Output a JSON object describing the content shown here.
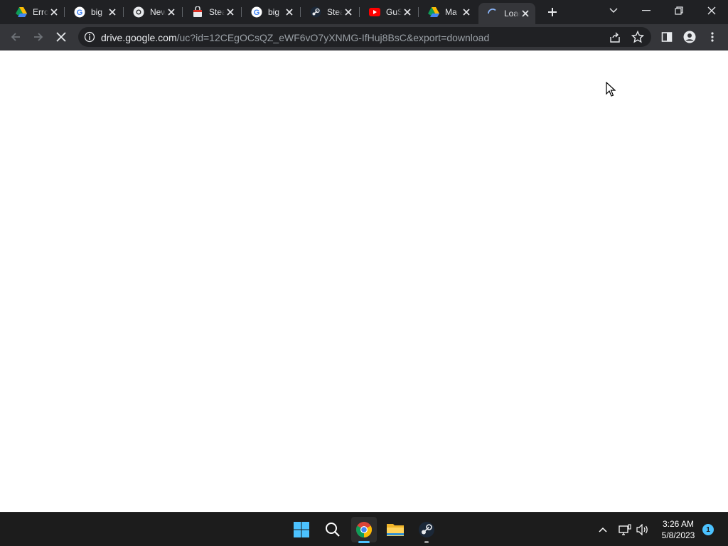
{
  "browser": {
    "tabs": [
      {
        "title": "Error",
        "icon": "google-drive-icon"
      },
      {
        "title": "big",
        "icon": "google-g-icon"
      },
      {
        "title": "New",
        "icon": "chrome-icon"
      },
      {
        "title": "Steam",
        "icon": "steam-store-icon"
      },
      {
        "title": "big",
        "icon": "google-g-icon"
      },
      {
        "title": "Steam",
        "icon": "steam-icon"
      },
      {
        "title": "GuS",
        "icon": "youtube-icon"
      },
      {
        "title": "Ma",
        "icon": "google-drive-icon"
      },
      {
        "title": "Loading",
        "icon": "loading-spinner-icon",
        "active": true
      }
    ],
    "new_tab": "+",
    "address": {
      "host": "drive.google.com",
      "path": "/uc?id=12CEgOCsQZ_eWF6vO7yXNMG-IfHuj8BsC&export=download"
    }
  },
  "taskbar": {
    "apps": [
      "windows-start-icon",
      "search-icon",
      "chrome-icon",
      "file-explorer-icon",
      "steam-icon"
    ],
    "clock": {
      "time": "3:26 AM",
      "date": "5/8/2023"
    },
    "notification_count": "1"
  },
  "colors": {
    "chrome_dark": "#202124",
    "toolbar": "#35363a",
    "taskbar": "#1c1c1c",
    "accent": "#4cc2ff"
  }
}
